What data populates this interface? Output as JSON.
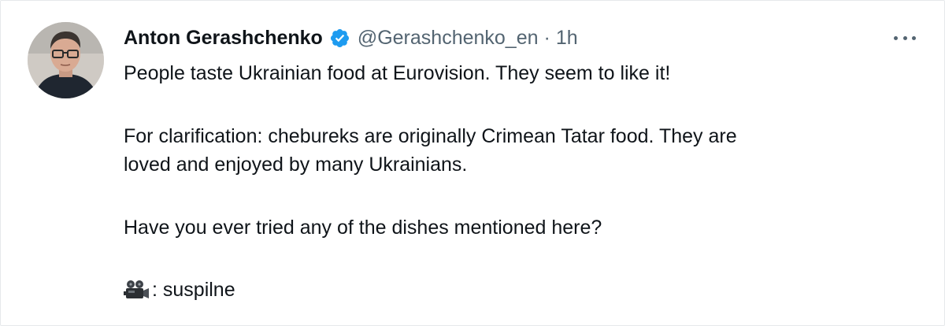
{
  "tweet": {
    "author": {
      "display_name": "Anton Gerashchenko",
      "handle": "@Gerashchenko_en",
      "separator": "·",
      "time": "1h",
      "verified": true,
      "avatar_icon": "person-photo-avatar"
    },
    "menu_icon": "more-horizontal-icon",
    "text": {
      "line1": "People taste Ukrainian food at Eurovision. They seem to like it!",
      "para2_line1": "For clarification: chebureks are originally Crimean Tatar food. They are",
      "para2_line2": "loved and enjoyed by many Ukrainians.",
      "para3": "Have you ever tried any of the dishes mentioned here?",
      "credit_text": ": suspilne",
      "credit_icon": "movie-camera-icon"
    }
  },
  "colors": {
    "text_primary": "#0f1419",
    "text_secondary": "#536471",
    "verified_blue": "#1d9bf0",
    "border": "#e6e9eb"
  }
}
